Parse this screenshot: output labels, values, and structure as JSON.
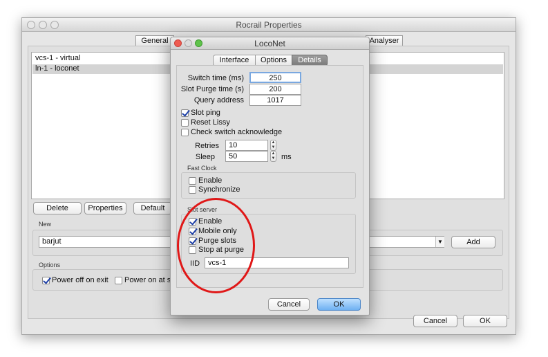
{
  "main_window": {
    "title": "Rocrail Properties",
    "tabs": {
      "general": "General",
      "analyser": "Analyser"
    },
    "list_items": [
      "vcs-1 - virtual",
      "ln-1 - loconet"
    ],
    "buttons": {
      "delete": "Delete",
      "properties": "Properties",
      "default": "Default",
      "add": "Add",
      "cancel": "Cancel",
      "ok": "OK"
    },
    "new_group": {
      "title": "New",
      "value": "barjut"
    },
    "options_group": {
      "title": "Options",
      "power_off": "Power off on exit",
      "power_on": "Power on at st"
    }
  },
  "loconet": {
    "title": "LocoNet",
    "tabs": [
      "Interface",
      "Options",
      "Details"
    ],
    "switch_time": {
      "label": "Switch time (ms)",
      "value": "250"
    },
    "slot_purge": {
      "label": "Slot Purge time (s)",
      "value": "200"
    },
    "query_address": {
      "label": "Query address",
      "value": "1017"
    },
    "slot_ping": "Slot ping",
    "reset_lissy": "Reset Lissy",
    "check_switch_ack": "Check switch acknowledge",
    "retries": {
      "label": "Retries",
      "value": "10"
    },
    "sleep": {
      "label": "Sleep",
      "value": "50",
      "unit": "ms"
    },
    "fast_clock": {
      "title": "Fast Clock",
      "enable": "Enable",
      "synchronize": "Synchronize"
    },
    "slot_server": {
      "title": "Slot server",
      "enable": "Enable",
      "mobile_only": "Mobile only",
      "purge_slots": "Purge slots",
      "stop_at_purge": "Stop at purge",
      "iid_label": "IID",
      "iid_value": "vcs-1"
    },
    "buttons": {
      "cancel": "Cancel",
      "ok": "OK"
    }
  },
  "colors": {
    "annotation": "#e01818",
    "selection": "#d4d4d4",
    "accent": "#6fb1f2"
  }
}
